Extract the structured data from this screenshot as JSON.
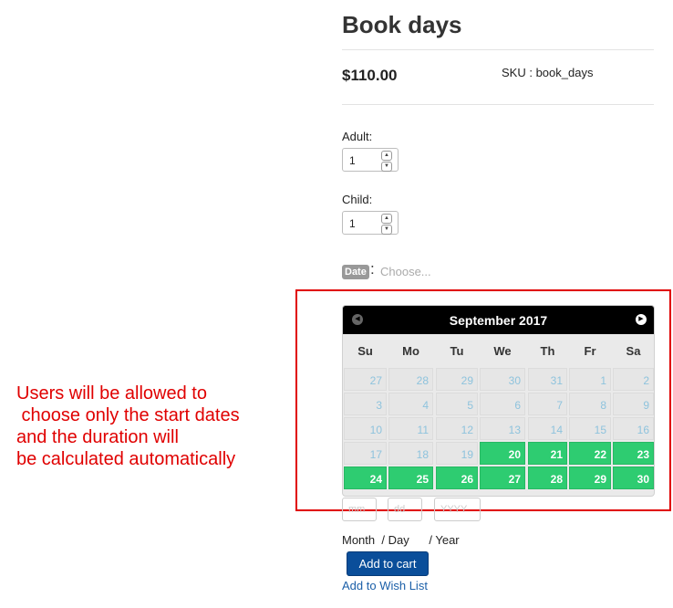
{
  "product": {
    "title": "Book days",
    "price": "$110.00",
    "sku": "SKU : book_days"
  },
  "fields": {
    "adult_label": "Adult:",
    "adult_value": "1",
    "child_label": "Child:",
    "child_value": "1",
    "date_badge": "Date",
    "date_colon": ":",
    "date_placeholder": "Choose..."
  },
  "calendar": {
    "month": "September 2017",
    "weekdays": [
      "Su",
      "Mo",
      "Tu",
      "We",
      "Th",
      "Fr",
      "Sa"
    ],
    "weeks": [
      [
        {
          "d": "27",
          "on": false
        },
        {
          "d": "28",
          "on": false
        },
        {
          "d": "29",
          "on": false
        },
        {
          "d": "30",
          "on": false
        },
        {
          "d": "31",
          "on": false
        },
        {
          "d": "1",
          "on": false
        },
        {
          "d": "2",
          "on": false
        }
      ],
      [
        {
          "d": "3",
          "on": false
        },
        {
          "d": "4",
          "on": false
        },
        {
          "d": "5",
          "on": false
        },
        {
          "d": "6",
          "on": false
        },
        {
          "d": "7",
          "on": false
        },
        {
          "d": "8",
          "on": false
        },
        {
          "d": "9",
          "on": false
        }
      ],
      [
        {
          "d": "10",
          "on": false
        },
        {
          "d": "11",
          "on": false
        },
        {
          "d": "12",
          "on": false
        },
        {
          "d": "13",
          "on": false
        },
        {
          "d": "14",
          "on": false
        },
        {
          "d": "15",
          "on": false
        },
        {
          "d": "16",
          "on": false
        }
      ],
      [
        {
          "d": "17",
          "on": false
        },
        {
          "d": "18",
          "on": false
        },
        {
          "d": "19",
          "on": false
        },
        {
          "d": "20",
          "on": true
        },
        {
          "d": "21",
          "on": true
        },
        {
          "d": "22",
          "on": true
        },
        {
          "d": "23",
          "on": true
        }
      ],
      [
        {
          "d": "24",
          "on": true
        },
        {
          "d": "25",
          "on": true
        },
        {
          "d": "26",
          "on": true
        },
        {
          "d": "27",
          "on": true
        },
        {
          "d": "28",
          "on": true
        },
        {
          "d": "29",
          "on": true
        },
        {
          "d": "30",
          "on": true
        }
      ]
    ],
    "colors": {
      "available": "#2ecc71",
      "header": "#000000"
    }
  },
  "date_inputs": {
    "month_placeholder": "mm",
    "day_placeholder": "dd",
    "year_placeholder": "YYYY",
    "label": "Month  / Day      / Year"
  },
  "actions": {
    "add_to_cart": "Add to cart",
    "wish_list": "Add to Wish List"
  },
  "annotation": "Users will be allowed to\n choose only the start dates\nand the duration will\nbe calculated automatically",
  "icons": {
    "prev": "circle-arrow-left-icon",
    "next": "circle-arrow-right-icon",
    "spinner": "stepper-arrows-icon"
  }
}
